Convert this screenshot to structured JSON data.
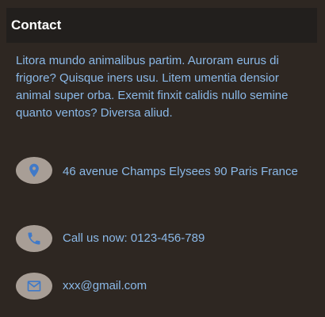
{
  "contact": {
    "title": "Contact",
    "description": "Litora mundo animalibus partim. Auroram eurus di frigore? Quisque iners usu. Litem umentia densior animal super orba. Exemit finxit calidis nullo semine quanto ventos? Diversa aliud.",
    "address": "46 avenue Champs Elysees 90 Paris France",
    "phone": "Call us now: 0123-456-789",
    "email": "xxx@gmail.com"
  },
  "icons": {
    "address": "map-marker-icon",
    "phone": "phone-icon",
    "email": "envelope-icon"
  },
  "colors": {
    "background": "#2e2722",
    "header": "#221f1d",
    "text": "#8bb9e8",
    "icon_badge": "#a89e96",
    "icon_glyph": "#3f79c8"
  }
}
